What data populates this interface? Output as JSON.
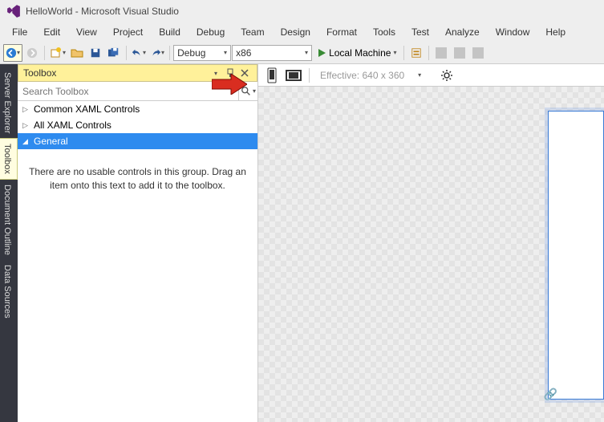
{
  "window": {
    "title": "HelloWorld - Microsoft Visual Studio"
  },
  "menu": [
    "File",
    "Edit",
    "View",
    "Project",
    "Build",
    "Debug",
    "Team",
    "Design",
    "Format",
    "Tools",
    "Test",
    "Analyze",
    "Window",
    "Help"
  ],
  "toolbar": {
    "config_label": "Debug",
    "platform_label": "x86",
    "run_label": "Local Machine"
  },
  "vert_tabs": [
    "Server Explorer",
    "Toolbox",
    "Document Outline",
    "Data Sources"
  ],
  "toolbox": {
    "title": "Toolbox",
    "search_placeholder": "Search Toolbox",
    "groups": [
      "Common XAML Controls",
      "All XAML Controls",
      "General"
    ],
    "empty_message": "There are no usable controls in this group. Drag an item onto this text to add it to the toolbox."
  },
  "designer": {
    "effective_label": "Effective: 640 x 360"
  }
}
